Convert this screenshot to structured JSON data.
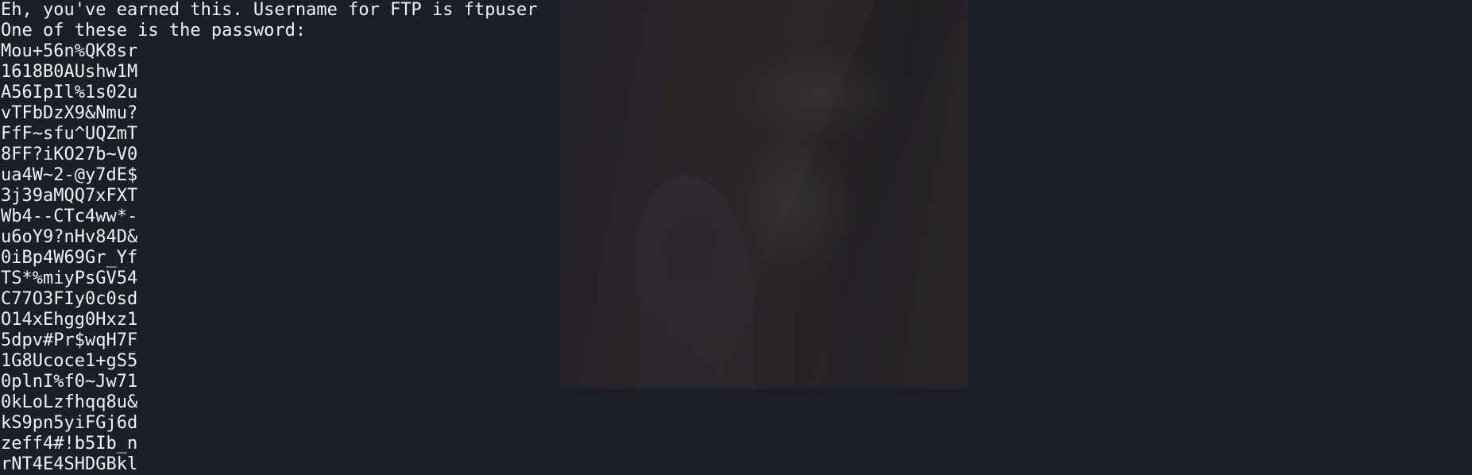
{
  "terminal": {
    "message_line_1": "Eh, you've earned this. Username for FTP is ftpuser",
    "message_line_2": "One of these is the password:",
    "passwords": [
      "Mou+56n%QK8sr",
      "1618B0AUshw1M",
      "A56IpIl%1s02u",
      "vTFbDzX9&Nmu?",
      "FfF~sfu^UQZmT",
      "8FF?iKO27b~V0",
      "ua4W~2-@y7dE$",
      "3j39aMQQ7xFXT",
      "Wb4--CTc4ww*-",
      "u6oY9?nHv84D&",
      "0iBp4W69Gr_Yf",
      "TS*%miyPsGV54",
      "C77O3FIy0c0sd",
      "O14xEhgg0Hxz1",
      "5dpv#Pr$wqH7F",
      "1G8Ucoce1+gS5",
      "0plnI%f0~Jw71",
      "0kLoLzfhqq8u&",
      "kS9pn5yiFGj6d",
      "zeff4#!b5Ib_n",
      "rNT4E4SHDGBkl"
    ]
  },
  "colors": {
    "background": "#1b1f27",
    "text": "#f2f2f2"
  }
}
